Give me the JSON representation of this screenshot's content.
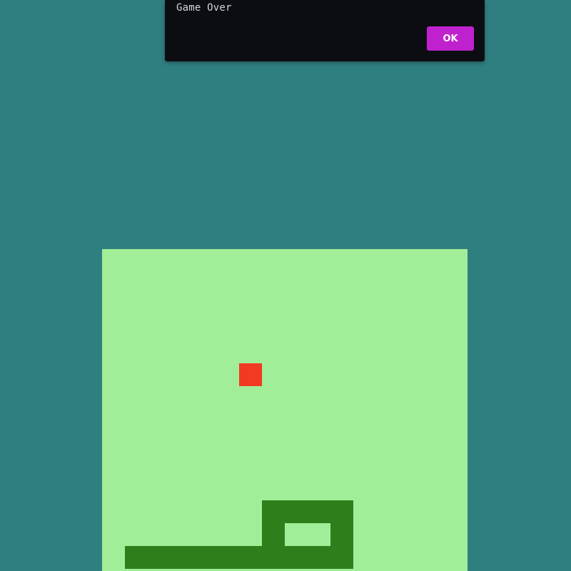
{
  "dialog": {
    "message": "Game Over",
    "ok_label": "OK"
  },
  "colors": {
    "background": "#307f80",
    "dialog_bg": "#0c0d12",
    "button": "#c021cf",
    "board": "#a2ee98",
    "snake": "#2f7e1c",
    "food": "#f23a22"
  },
  "game": {
    "grid_columns": 16,
    "food": {
      "col": 6,
      "row": 5
    },
    "snake": [
      {
        "col": 1,
        "row": 13
      },
      {
        "col": 2,
        "row": 13
      },
      {
        "col": 3,
        "row": 13
      },
      {
        "col": 4,
        "row": 13
      },
      {
        "col": 5,
        "row": 13
      },
      {
        "col": 6,
        "row": 13
      },
      {
        "col": 7,
        "row": 13
      },
      {
        "col": 8,
        "row": 13
      },
      {
        "col": 9,
        "row": 13
      },
      {
        "col": 10,
        "row": 13
      },
      {
        "col": 10,
        "row": 12
      },
      {
        "col": 10,
        "row": 11
      },
      {
        "col": 9,
        "row": 11
      },
      {
        "col": 8,
        "row": 11
      },
      {
        "col": 7,
        "row": 11
      },
      {
        "col": 7,
        "row": 12
      },
      {
        "col": 7,
        "row": 13
      }
    ]
  }
}
